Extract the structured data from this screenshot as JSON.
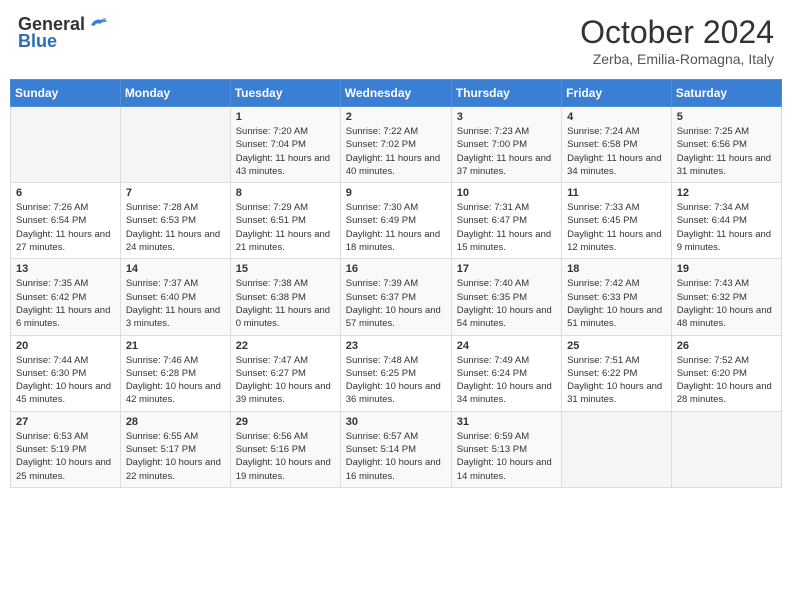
{
  "header": {
    "logo_general": "General",
    "logo_blue": "Blue",
    "month_title": "October 2024",
    "subtitle": "Zerba, Emilia-Romagna, Italy"
  },
  "weekdays": [
    "Sunday",
    "Monday",
    "Tuesday",
    "Wednesday",
    "Thursday",
    "Friday",
    "Saturday"
  ],
  "weeks": [
    [
      {
        "day": "",
        "sunrise": "",
        "sunset": "",
        "daylight": ""
      },
      {
        "day": "",
        "sunrise": "",
        "sunset": "",
        "daylight": ""
      },
      {
        "day": "1",
        "sunrise": "Sunrise: 7:20 AM",
        "sunset": "Sunset: 7:04 PM",
        "daylight": "Daylight: 11 hours and 43 minutes."
      },
      {
        "day": "2",
        "sunrise": "Sunrise: 7:22 AM",
        "sunset": "Sunset: 7:02 PM",
        "daylight": "Daylight: 11 hours and 40 minutes."
      },
      {
        "day": "3",
        "sunrise": "Sunrise: 7:23 AM",
        "sunset": "Sunset: 7:00 PM",
        "daylight": "Daylight: 11 hours and 37 minutes."
      },
      {
        "day": "4",
        "sunrise": "Sunrise: 7:24 AM",
        "sunset": "Sunset: 6:58 PM",
        "daylight": "Daylight: 11 hours and 34 minutes."
      },
      {
        "day": "5",
        "sunrise": "Sunrise: 7:25 AM",
        "sunset": "Sunset: 6:56 PM",
        "daylight": "Daylight: 11 hours and 31 minutes."
      }
    ],
    [
      {
        "day": "6",
        "sunrise": "Sunrise: 7:26 AM",
        "sunset": "Sunset: 6:54 PM",
        "daylight": "Daylight: 11 hours and 27 minutes."
      },
      {
        "day": "7",
        "sunrise": "Sunrise: 7:28 AM",
        "sunset": "Sunset: 6:53 PM",
        "daylight": "Daylight: 11 hours and 24 minutes."
      },
      {
        "day": "8",
        "sunrise": "Sunrise: 7:29 AM",
        "sunset": "Sunset: 6:51 PM",
        "daylight": "Daylight: 11 hours and 21 minutes."
      },
      {
        "day": "9",
        "sunrise": "Sunrise: 7:30 AM",
        "sunset": "Sunset: 6:49 PM",
        "daylight": "Daylight: 11 hours and 18 minutes."
      },
      {
        "day": "10",
        "sunrise": "Sunrise: 7:31 AM",
        "sunset": "Sunset: 6:47 PM",
        "daylight": "Daylight: 11 hours and 15 minutes."
      },
      {
        "day": "11",
        "sunrise": "Sunrise: 7:33 AM",
        "sunset": "Sunset: 6:45 PM",
        "daylight": "Daylight: 11 hours and 12 minutes."
      },
      {
        "day": "12",
        "sunrise": "Sunrise: 7:34 AM",
        "sunset": "Sunset: 6:44 PM",
        "daylight": "Daylight: 11 hours and 9 minutes."
      }
    ],
    [
      {
        "day": "13",
        "sunrise": "Sunrise: 7:35 AM",
        "sunset": "Sunset: 6:42 PM",
        "daylight": "Daylight: 11 hours and 6 minutes."
      },
      {
        "day": "14",
        "sunrise": "Sunrise: 7:37 AM",
        "sunset": "Sunset: 6:40 PM",
        "daylight": "Daylight: 11 hours and 3 minutes."
      },
      {
        "day": "15",
        "sunrise": "Sunrise: 7:38 AM",
        "sunset": "Sunset: 6:38 PM",
        "daylight": "Daylight: 11 hours and 0 minutes."
      },
      {
        "day": "16",
        "sunrise": "Sunrise: 7:39 AM",
        "sunset": "Sunset: 6:37 PM",
        "daylight": "Daylight: 10 hours and 57 minutes."
      },
      {
        "day": "17",
        "sunrise": "Sunrise: 7:40 AM",
        "sunset": "Sunset: 6:35 PM",
        "daylight": "Daylight: 10 hours and 54 minutes."
      },
      {
        "day": "18",
        "sunrise": "Sunrise: 7:42 AM",
        "sunset": "Sunset: 6:33 PM",
        "daylight": "Daylight: 10 hours and 51 minutes."
      },
      {
        "day": "19",
        "sunrise": "Sunrise: 7:43 AM",
        "sunset": "Sunset: 6:32 PM",
        "daylight": "Daylight: 10 hours and 48 minutes."
      }
    ],
    [
      {
        "day": "20",
        "sunrise": "Sunrise: 7:44 AM",
        "sunset": "Sunset: 6:30 PM",
        "daylight": "Daylight: 10 hours and 45 minutes."
      },
      {
        "day": "21",
        "sunrise": "Sunrise: 7:46 AM",
        "sunset": "Sunset: 6:28 PM",
        "daylight": "Daylight: 10 hours and 42 minutes."
      },
      {
        "day": "22",
        "sunrise": "Sunrise: 7:47 AM",
        "sunset": "Sunset: 6:27 PM",
        "daylight": "Daylight: 10 hours and 39 minutes."
      },
      {
        "day": "23",
        "sunrise": "Sunrise: 7:48 AM",
        "sunset": "Sunset: 6:25 PM",
        "daylight": "Daylight: 10 hours and 36 minutes."
      },
      {
        "day": "24",
        "sunrise": "Sunrise: 7:49 AM",
        "sunset": "Sunset: 6:24 PM",
        "daylight": "Daylight: 10 hours and 34 minutes."
      },
      {
        "day": "25",
        "sunrise": "Sunrise: 7:51 AM",
        "sunset": "Sunset: 6:22 PM",
        "daylight": "Daylight: 10 hours and 31 minutes."
      },
      {
        "day": "26",
        "sunrise": "Sunrise: 7:52 AM",
        "sunset": "Sunset: 6:20 PM",
        "daylight": "Daylight: 10 hours and 28 minutes."
      }
    ],
    [
      {
        "day": "27",
        "sunrise": "Sunrise: 6:53 AM",
        "sunset": "Sunset: 5:19 PM",
        "daylight": "Daylight: 10 hours and 25 minutes."
      },
      {
        "day": "28",
        "sunrise": "Sunrise: 6:55 AM",
        "sunset": "Sunset: 5:17 PM",
        "daylight": "Daylight: 10 hours and 22 minutes."
      },
      {
        "day": "29",
        "sunrise": "Sunrise: 6:56 AM",
        "sunset": "Sunset: 5:16 PM",
        "daylight": "Daylight: 10 hours and 19 minutes."
      },
      {
        "day": "30",
        "sunrise": "Sunrise: 6:57 AM",
        "sunset": "Sunset: 5:14 PM",
        "daylight": "Daylight: 10 hours and 16 minutes."
      },
      {
        "day": "31",
        "sunrise": "Sunrise: 6:59 AM",
        "sunset": "Sunset: 5:13 PM",
        "daylight": "Daylight: 10 hours and 14 minutes."
      },
      {
        "day": "",
        "sunrise": "",
        "sunset": "",
        "daylight": ""
      },
      {
        "day": "",
        "sunrise": "",
        "sunset": "",
        "daylight": ""
      }
    ]
  ]
}
